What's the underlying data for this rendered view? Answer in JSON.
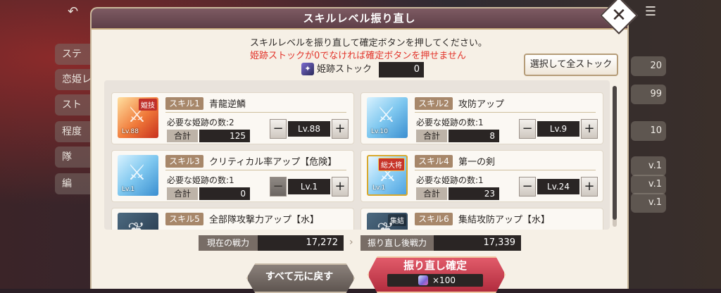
{
  "background": {
    "left_menu": [
      "ステ",
      "恋姫レ",
      "スト",
      "程度",
      "隊",
      "編"
    ],
    "right_values": [
      "20",
      "99",
      "10",
      "v.1",
      "v.1",
      "v.1"
    ]
  },
  "dialog": {
    "title": "スキルレベル振り直し",
    "close_symbol": "✕",
    "instruction": "スキルレベルを振り直して確定ボタンを押してください。",
    "warning": "姫跡ストックが0でなければ確定ボタンを押せません",
    "stock_label": "姫跡ストック",
    "stock_value": "0",
    "select_all_label": "選択して全ストック"
  },
  "common": {
    "sum_label": "合計",
    "minus": "−",
    "plus": "+"
  },
  "skills": [
    {
      "slot": "スキル1",
      "name": "青龍逆鱗",
      "need": "必要な姫跡の数:2",
      "total": "125",
      "level": "Lv.88",
      "icon_level": "Lv.88",
      "tag": "姫技",
      "icon_style": "red",
      "minus_disabled": false
    },
    {
      "slot": "スキル2",
      "name": "攻防アップ",
      "need": "必要な姫跡の数:1",
      "total": "8",
      "level": "Lv.9",
      "icon_level": "Lv.10",
      "tag": "",
      "icon_style": "blue",
      "minus_disabled": false
    },
    {
      "slot": "スキル3",
      "name": "クリティカル率アップ【危険】",
      "need": "必要な姫跡の数:1",
      "total": "0",
      "level": "Lv.1",
      "icon_level": "Lv.1",
      "tag": "",
      "icon_style": "blue",
      "minus_disabled": true
    },
    {
      "slot": "スキル4",
      "name": "第一の剣",
      "need": "必要な姫跡の数:1",
      "total": "23",
      "level": "Lv.24",
      "icon_level": "Lv.1",
      "tag": "総大将",
      "icon_style": "blue2",
      "minus_disabled": false
    },
    {
      "slot": "スキル5",
      "name": "全部隊攻撃力アップ【水】",
      "tag": "",
      "icon_style": "dark"
    },
    {
      "slot": "スキル6",
      "name": "集結攻防アップ【水】",
      "tag": "集結",
      "icon_style": "dark"
    }
  ],
  "power": {
    "current_label": "現在の戦力",
    "current_value": "17,272",
    "after_label": "振り直し後戦力",
    "after_value": "17,339"
  },
  "buttons": {
    "reset_label": "すべて元に戻す",
    "confirm_label": "振り直し確定",
    "cost_label": "×100"
  }
}
